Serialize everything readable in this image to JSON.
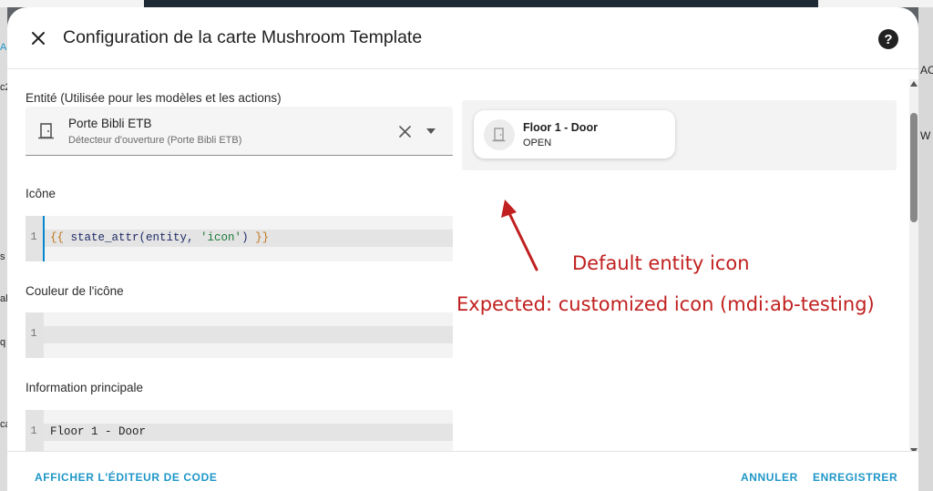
{
  "background": {
    "left_fragments": [
      "A",
      "c2",
      "s",
      "al",
      "q",
      "ca"
    ],
    "right_fragments": [
      "AC",
      "W"
    ]
  },
  "dialog": {
    "title": "Configuration de la carte Mushroom Template",
    "help_glyph": "?"
  },
  "form": {
    "entity": {
      "label": "Entité (Utilisée pour les modèles et les actions)",
      "name": "Porte Bibli ETB",
      "subtitle": "Détecteur d'ouverture (Porte Bibli ETB)"
    },
    "icon": {
      "label": "Icône",
      "line_number": "1",
      "code": {
        "open": "{{",
        "fn": " state_attr(entity, ",
        "str": "'icon'",
        "close_paren": ") ",
        "close": "}}"
      }
    },
    "icon_color": {
      "label": "Couleur de l'icône",
      "line_number": "1",
      "code": ""
    },
    "primary": {
      "label": "Information principale",
      "line_number": "1",
      "code": "Floor 1 - Door"
    }
  },
  "preview": {
    "card_name": "Floor 1 - Door",
    "card_state": "OPEN",
    "icon": "door-icon"
  },
  "annotations": {
    "line1": "Default entity icon",
    "line2": "Expected: customized icon (mdi:ab-testing)",
    "color": "#c0201f"
  },
  "footer": {
    "code_editor": "AFFICHER L'ÉDITEUR DE CODE",
    "cancel": "ANNULER",
    "save": "ENREGISTRER"
  },
  "colors": {
    "accent": "#1e96c8",
    "focus": "#0288d1"
  }
}
